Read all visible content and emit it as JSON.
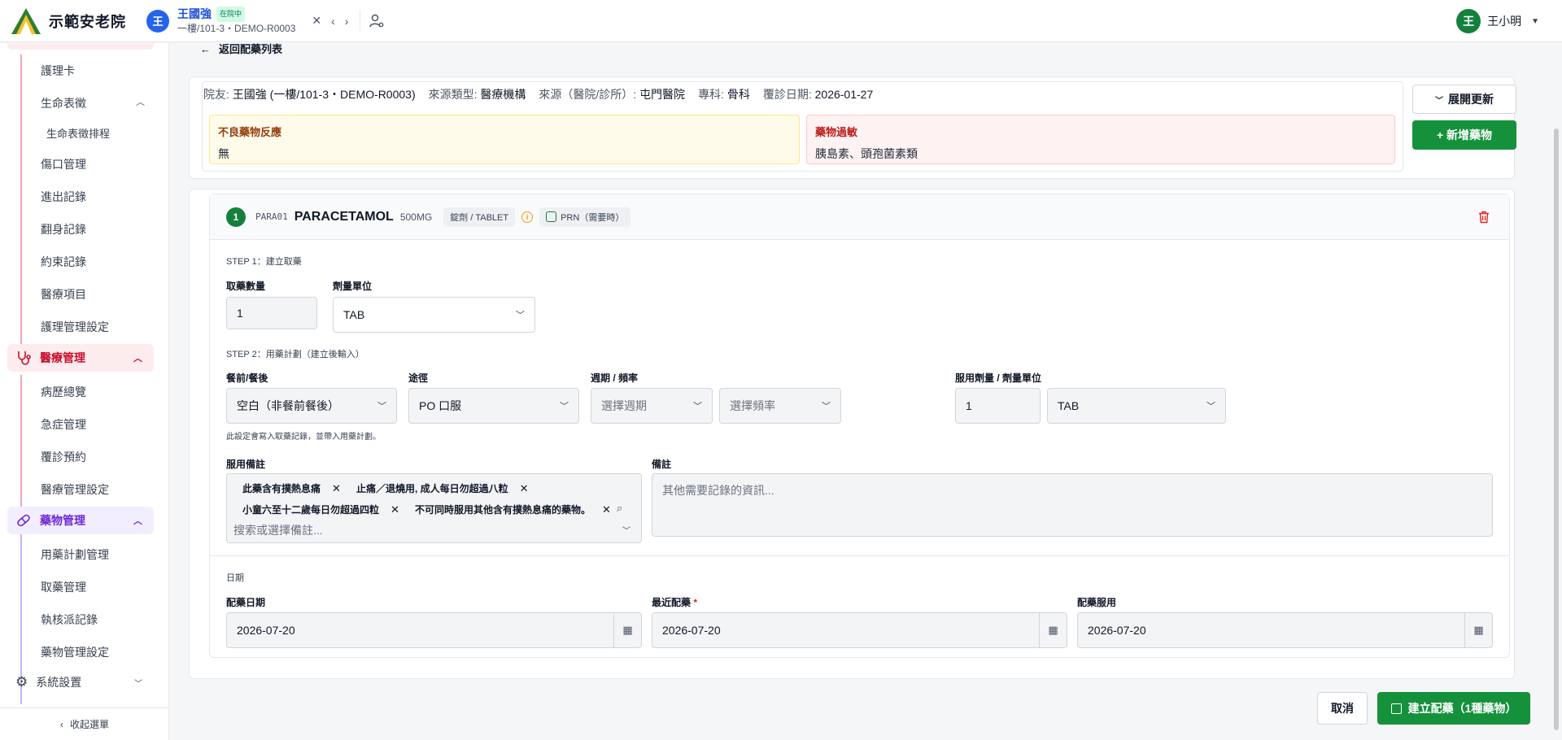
{
  "brand": {
    "name": "示範安老院"
  },
  "resident": {
    "avatar": "王",
    "name": "王國強",
    "status": "在院中",
    "location": "一樓/101-3・DEMO-R0003"
  },
  "user": {
    "avatar": "王",
    "name": "王小明"
  },
  "sidebar": {
    "items_top": [
      "護理卡",
      "生命表徵",
      "生命表徵排程",
      "傷口管理",
      "進出記錄",
      "翻身記錄",
      "約束記錄",
      "醫療項目",
      "護理管理設定"
    ],
    "group_medical": "醫療管理",
    "items_medical": [
      "病歷總覽",
      "急症管理",
      "覆診預約",
      "醫療管理設定"
    ],
    "group_drug": "藥物管理",
    "items_drug": [
      "用藥計劃管理",
      "取藥管理",
      "執核派記錄",
      "藥物管理設定"
    ],
    "group_system": "系統設置",
    "collapse": "收起選單"
  },
  "main": {
    "back": "返回配藥列表",
    "info": {
      "resident_k": "院友:",
      "resident_v": "王國強 (一樓/101-3・DEMO-R0003)",
      "source_type_k": "來源類型:",
      "source_type_v": "醫療機構",
      "source_k": "來源（醫院/診所）:",
      "source_v": "屯門醫院",
      "specialty_k": "專科:",
      "specialty_v": "骨科",
      "followup_k": "覆診日期:",
      "followup_v": "2026-01-27"
    },
    "adr": {
      "title": "不良藥物反應",
      "value": "無"
    },
    "allergy": {
      "title": "藥物過敏",
      "value": "胰島素、頭孢菌素類"
    },
    "expand_update": "展開更新",
    "add_drug": "+ 新增藥物",
    "med": {
      "index": "1",
      "code": "PARA01",
      "name": "PARACETAMOL",
      "dose": "500MG",
      "form": "錠劑 / TABLET",
      "prn": "PRN（需要時）"
    },
    "step1": {
      "title": "STEP 1：建立取藥",
      "qty_label": "取藥數量",
      "qty_value": "1",
      "unit_label": "劑量單位",
      "unit_value": "TAB"
    },
    "step2": {
      "title": "STEP 2：用藥計劃（建立後輸入）",
      "meal_label": "餐前/餐後",
      "meal_value": "空白（非餐前餐後）",
      "route_label": "途徑",
      "route_value": "PO 口服",
      "freq_label": "週期 / 頻率",
      "cycle_ph": "選擇週期",
      "freq_ph": "選擇頻率",
      "dose_label": "服用劑量 / 劑量單位",
      "dose_value": "1",
      "dose_unit": "TAB",
      "hint": "此設定會寫入取藥記錄，並帶入用藥計劃。"
    },
    "notes": {
      "label": "服用備註",
      "tags": [
        "此藥含有撲熱息痛",
        "止痛／退燒用, 成人每日勿超過八粒",
        "小童六至十二歲每日勿超過四粒",
        "不可同時服用其他含有撲熱息痛的藥物。"
      ],
      "placeholder": "搜索或選擇備註..."
    },
    "remarks": {
      "label": "備註",
      "placeholder": "其他需要記錄的資訊..."
    },
    "dates": {
      "title": "日期",
      "dispense_label": "配藥日期",
      "dispense_value": "2026-07-20",
      "recent_label": "最近配藥",
      "recent_value": "2026-07-20",
      "use_label": "配藥服用",
      "use_value": "2026-07-20"
    },
    "cancel": "取消",
    "create": "建立配藥（1種藥物）"
  },
  "colors": {
    "brand_green": "#15913c",
    "accent_red": "#dc2626",
    "purple": "#7c3aed"
  }
}
